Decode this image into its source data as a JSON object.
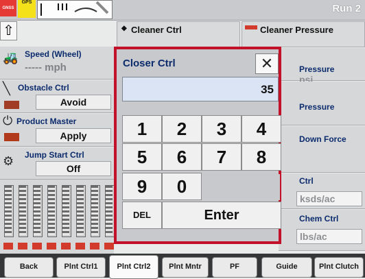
{
  "status": {
    "warning_text": "GNSS",
    "gps_text": "GPS",
    "run_label": "Run 2"
  },
  "top_panels": {
    "cleaner_ctrl": "Cleaner Ctrl",
    "cleaner_pressure": "Cleaner Pressure"
  },
  "left_panels": {
    "speed": {
      "label": "Speed (Wheel)",
      "value": "----- mph"
    },
    "obstacle": {
      "label": "Obstacle Ctrl",
      "value": "Avoid"
    },
    "product_master": {
      "label": "Product Master",
      "value": "Apply"
    },
    "jump_start": {
      "label": "Jump Start Ctrl",
      "value": "Off"
    }
  },
  "right_panels": {
    "pressure1": {
      "label": "Pressure",
      "value": "psi"
    },
    "pressure2": {
      "label": "Pressure"
    },
    "down_force": {
      "label": "Down Force"
    },
    "ctrl": {
      "label": "Ctrl",
      "value": "ksds/ac"
    },
    "chem": {
      "label": "Chem Ctrl",
      "value": "lbs/ac"
    }
  },
  "dialog": {
    "title": "Closer Ctrl",
    "close_symbol": "✕",
    "display_value": "35",
    "keys": [
      "1",
      "2",
      "3",
      "4",
      "5",
      "6",
      "7",
      "8",
      "9",
      "0"
    ],
    "del_label": "DEL",
    "enter_label": "Enter"
  },
  "tabs": [
    "Back",
    "Plnt Ctrl1",
    "Plnt Ctrl2",
    "Plnt Mntr",
    "PF",
    "Guide",
    "Plnt Clutch"
  ],
  "active_tab": "Plnt Ctrl2",
  "colors": {
    "dialog_border": "#c2122a",
    "display_bg": "#dbe4f5",
    "label_blue": "#0b2b6d"
  }
}
